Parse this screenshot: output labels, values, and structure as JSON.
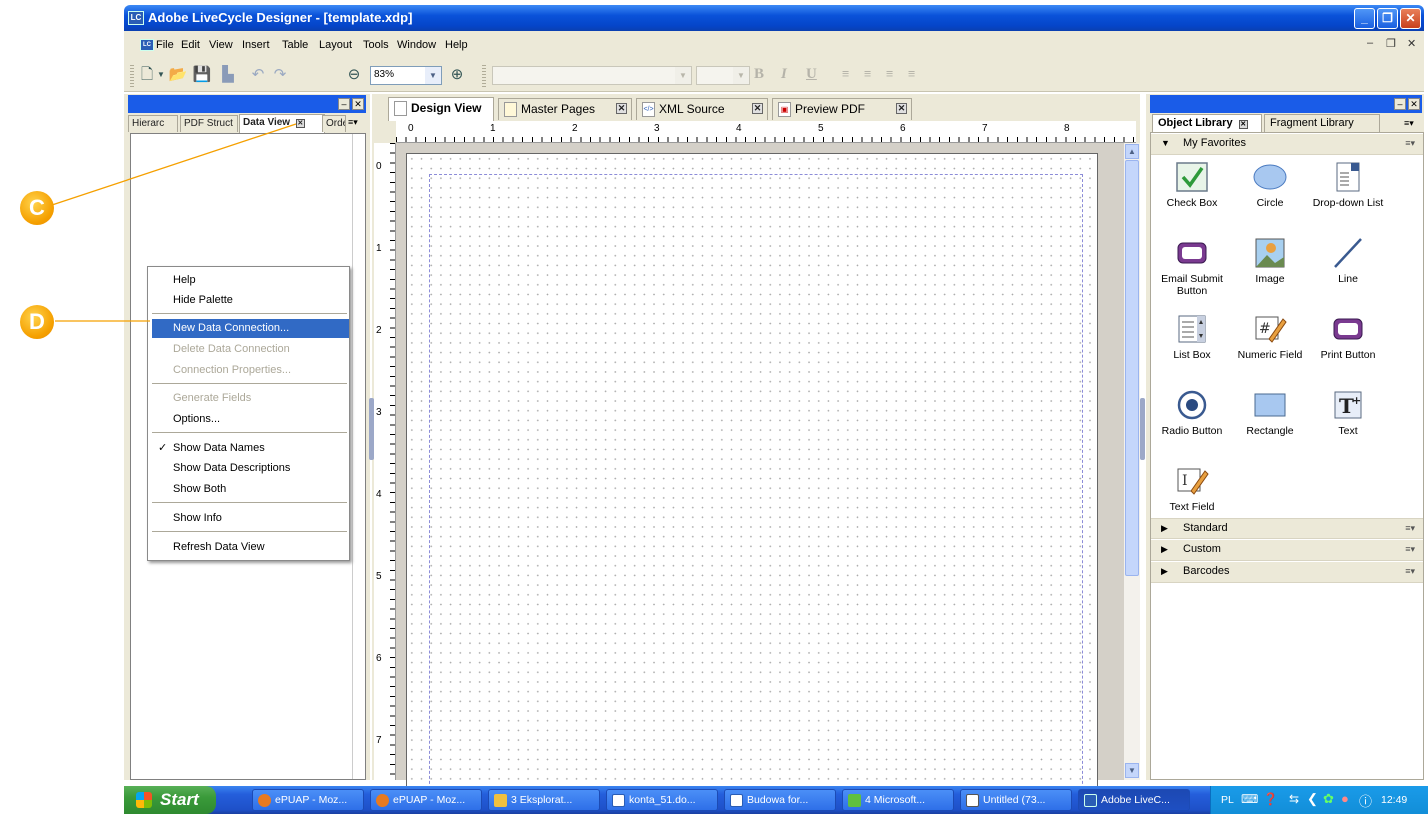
{
  "window": {
    "title": "Adobe LiveCycle Designer - [template.xdp]",
    "app_icon": "LC"
  },
  "menubar": [
    "File",
    "Edit",
    "View",
    "Insert",
    "Table",
    "Layout",
    "Tools",
    "Window",
    "Help"
  ],
  "toolbar": {
    "zoom": "83%"
  },
  "left_panel": {
    "tabs": [
      "Hierarc",
      "PDF Struct",
      "Data View",
      "Orde"
    ]
  },
  "context_menu": {
    "items": [
      {
        "label": "Help",
        "state": "normal"
      },
      {
        "label": "Hide Palette",
        "state": "normal"
      },
      {
        "label": "New Data Connection...",
        "state": "highlighted"
      },
      {
        "label": "Delete Data Connection",
        "state": "disabled"
      },
      {
        "label": "Connection Properties...",
        "state": "disabled"
      },
      {
        "label": "Generate Fields",
        "state": "disabled"
      },
      {
        "label": "Options...",
        "state": "normal"
      },
      {
        "label": "Show Data Names",
        "state": "checked"
      },
      {
        "label": "Show Data Descriptions",
        "state": "normal"
      },
      {
        "label": "Show Both",
        "state": "normal"
      },
      {
        "label": "Show Info",
        "state": "normal"
      },
      {
        "label": "Refresh Data View",
        "state": "normal"
      }
    ]
  },
  "callouts": [
    "C",
    "D"
  ],
  "center": {
    "tabs": [
      "Design View",
      "Master Pages",
      "XML Source",
      "Preview PDF"
    ],
    "ruler_h": [
      "0",
      "1",
      "2",
      "3",
      "4",
      "5",
      "6",
      "7",
      "8"
    ],
    "ruler_v": [
      "0",
      "1",
      "2",
      "3",
      "4",
      "5",
      "6",
      "7"
    ]
  },
  "right_panel": {
    "tabs": [
      "Object Library",
      "Fragment Library"
    ],
    "favorites_title": "My Favorites",
    "objects": [
      "Check Box",
      "Circle",
      "Drop-down List",
      "Email Submit Button",
      "Image",
      "Line",
      "List Box",
      "Numeric Field",
      "Print Button",
      "Radio Button",
      "Rectangle",
      "Text",
      "Text Field"
    ],
    "sections": [
      "Standard",
      "Custom",
      "Barcodes"
    ]
  },
  "taskbar": {
    "start": "Start",
    "buttons": [
      "ePUAP - Moz...",
      "ePUAP - Moz...",
      "3 Eksplorat...",
      "konta_51.do...",
      "Budowa for...",
      "4 Microsoft...",
      "Untitled (73...",
      "Adobe LiveC..."
    ],
    "tray_lang": "PL",
    "clock": "12:49"
  }
}
